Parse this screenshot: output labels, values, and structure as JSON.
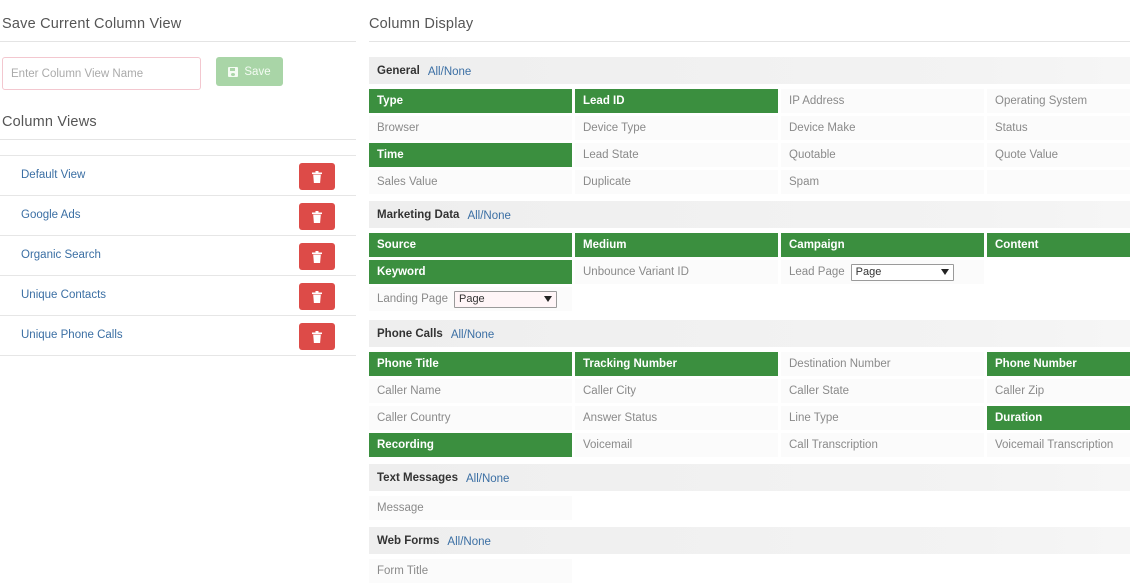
{
  "left": {
    "save_title": "Save Current Column View",
    "input_placeholder": "Enter Column View Name",
    "save_label": "Save",
    "views_title": "Column Views",
    "views": [
      "Default View",
      "Google Ads",
      "Organic Search",
      "Unique Contacts",
      "Unique Phone Calls"
    ]
  },
  "right": {
    "title": "Column Display",
    "toggle_all": "All",
    "toggle_sep": "/",
    "toggle_none": "None",
    "general": {
      "name": "General",
      "cells": [
        {
          "label": "Type",
          "on": true
        },
        {
          "label": "Lead ID",
          "on": true
        },
        {
          "label": "IP Address",
          "on": false
        },
        {
          "label": "Operating System",
          "on": false
        },
        {
          "label": "Browser",
          "on": false
        },
        {
          "label": "Device Type",
          "on": false
        },
        {
          "label": "Device Make",
          "on": false
        },
        {
          "label": "Status",
          "on": false
        },
        {
          "label": "Time",
          "on": true
        },
        {
          "label": "Lead State",
          "on": false
        },
        {
          "label": "Quotable",
          "on": false
        },
        {
          "label": "Quote Value",
          "on": false
        },
        {
          "label": "Sales Value",
          "on": false
        },
        {
          "label": "Duplicate",
          "on": false
        },
        {
          "label": "Spam",
          "on": false
        },
        {
          "label": "",
          "on": false
        }
      ]
    },
    "marketing": {
      "name": "Marketing Data",
      "cells": [
        {
          "label": "Source",
          "on": true
        },
        {
          "label": "Medium",
          "on": true
        },
        {
          "label": "Campaign",
          "on": true
        },
        {
          "label": "Content",
          "on": true
        },
        {
          "label": "Keyword",
          "on": true
        },
        {
          "label": "Unbounce Variant ID",
          "on": false
        },
        {
          "label": "Lead Page",
          "on": false,
          "select": "Page"
        },
        {
          "label": "",
          "on": false
        },
        {
          "label": "Landing Page",
          "on": false,
          "select": "Page"
        },
        {
          "label": "",
          "on": false
        },
        {
          "label": "",
          "on": false
        },
        {
          "label": "",
          "on": false
        }
      ]
    },
    "phone": {
      "name": "Phone Calls",
      "cells": [
        {
          "label": "Phone Title",
          "on": true
        },
        {
          "label": "Tracking Number",
          "on": true
        },
        {
          "label": "Destination Number",
          "on": false
        },
        {
          "label": "Phone Number",
          "on": true
        },
        {
          "label": "Caller Name",
          "on": false
        },
        {
          "label": "Caller City",
          "on": false
        },
        {
          "label": "Caller State",
          "on": false
        },
        {
          "label": "Caller Zip",
          "on": false
        },
        {
          "label": "Caller Country",
          "on": false
        },
        {
          "label": "Answer Status",
          "on": false
        },
        {
          "label": "Line Type",
          "on": false
        },
        {
          "label": "Duration",
          "on": true
        },
        {
          "label": "Recording",
          "on": true
        },
        {
          "label": "Voicemail",
          "on": false
        },
        {
          "label": "Call Transcription",
          "on": false
        },
        {
          "label": "Voicemail Transcription",
          "on": false
        }
      ]
    },
    "text": {
      "name": "Text Messages",
      "cells": [
        {
          "label": "Message",
          "on": false
        },
        {
          "label": "",
          "on": false
        },
        {
          "label": "",
          "on": false
        },
        {
          "label": "",
          "on": false
        }
      ]
    },
    "web": {
      "name": "Web Forms",
      "cells": [
        {
          "label": "Form Title",
          "on": false
        },
        {
          "label": "",
          "on": false
        },
        {
          "label": "",
          "on": false
        },
        {
          "label": "",
          "on": false
        }
      ]
    }
  },
  "colors": {
    "selected_green": "#3b8f3f",
    "delete_red": "#dd4b48",
    "save_green_disabled": "#a9d5a7",
    "link_blue": "#3b6fa4"
  }
}
